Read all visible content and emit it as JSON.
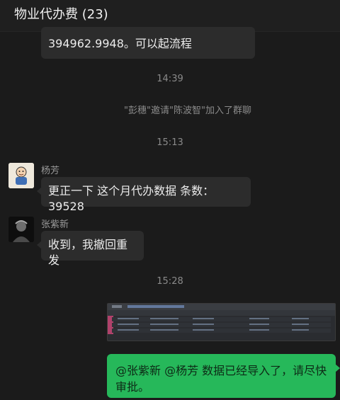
{
  "header": {
    "title": "物业代办费 (23)"
  },
  "messages": {
    "top_bubble": "394962.9948。可以起流程",
    "time1": "14:39",
    "system": "\"彭穗\"邀请\"陈波智\"加入了群聊",
    "time2": "15:13",
    "msg1_sender": "杨芳",
    "msg1_text": "更正一下 这个月代办数据  条数：39528",
    "msg2_sender": "张紫新",
    "msg2_text": "收到，我撤回重发",
    "time3": "15:28",
    "self_text": "@张紫新 @杨芳 数据已经导入了，请尽快审批。"
  },
  "colors": {
    "self_bubble": "#26b85a",
    "other_bubble": "#2c2c2c",
    "background": "#1b1b1b"
  },
  "icons": {
    "avatar1": "cartoon-avatar",
    "avatar2": "dark-portrait-avatar",
    "image": "spreadsheet-screenshot"
  }
}
